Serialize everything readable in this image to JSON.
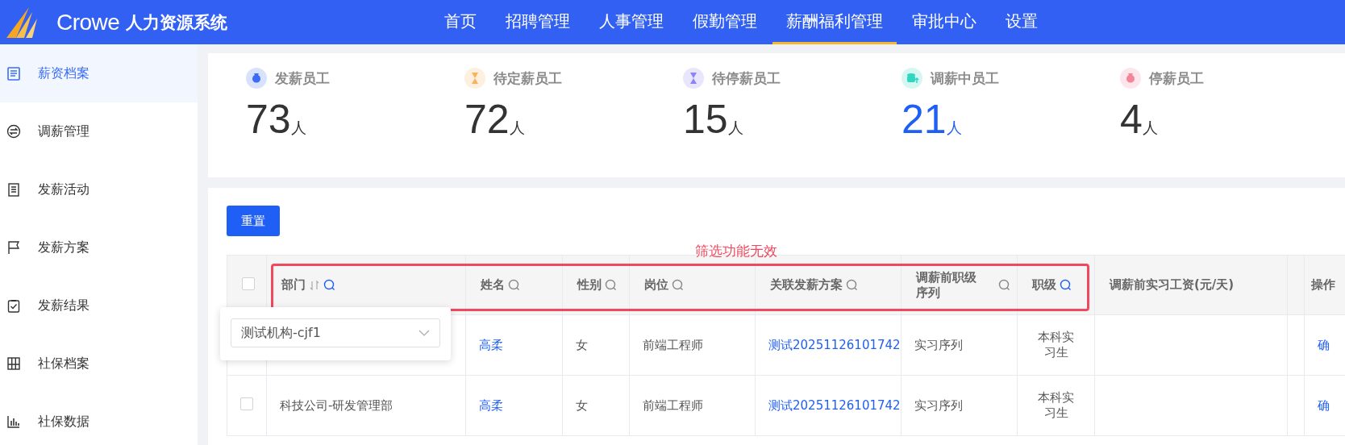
{
  "header": {
    "logo_text": "Crowe",
    "system_name": "人力资源系统",
    "nav": [
      {
        "label": "首页",
        "selected": false
      },
      {
        "label": "招聘管理",
        "selected": false
      },
      {
        "label": "人事管理",
        "selected": false
      },
      {
        "label": "假勤管理",
        "selected": false
      },
      {
        "label": "薪酬福利管理",
        "selected": true
      },
      {
        "label": "审批中心",
        "selected": false
      },
      {
        "label": "设置",
        "selected": false
      }
    ]
  },
  "sidebar": {
    "items": [
      {
        "label": "薪资档案",
        "kind": "document",
        "selected": true
      },
      {
        "label": "调薪管理",
        "kind": "exchange",
        "selected": false
      },
      {
        "label": "发薪活动",
        "kind": "list",
        "selected": false
      },
      {
        "label": "发薪方案",
        "kind": "flag",
        "selected": false
      },
      {
        "label": "发薪结果",
        "kind": "clipboard",
        "selected": false
      },
      {
        "label": "社保档案",
        "kind": "binders",
        "selected": false
      },
      {
        "label": "社保数据",
        "kind": "chart",
        "selected": false
      }
    ]
  },
  "stats": [
    {
      "label": "发薪员工",
      "value": "73",
      "unit": "人",
      "color": "#3b6cf6",
      "kind": "bag",
      "highlight": false
    },
    {
      "label": "待定薪员工",
      "value": "72",
      "unit": "人",
      "color": "#f7b35a",
      "kind": "hourglass",
      "highlight": false
    },
    {
      "label": "待停薪员工",
      "value": "15",
      "unit": "人",
      "color": "#8d83f2",
      "kind": "hourglass",
      "highlight": false
    },
    {
      "label": "调薪中员工",
      "value": "21",
      "unit": "人",
      "color": "#2fd6c0",
      "kind": "coins",
      "highlight": true
    },
    {
      "label": "停薪员工",
      "value": "4",
      "unit": "人",
      "color": "#f4849a",
      "kind": "bag",
      "highlight": false
    }
  ],
  "reset_button": "重置",
  "annotation": {
    "text": "筛选功能无效"
  },
  "filter_popover": {
    "value": "测试机构-cjf1"
  },
  "table": {
    "select_all_checked": false,
    "columns": [
      {
        "kind": "check"
      },
      {
        "label": "部门",
        "kind": "text",
        "filterable": true,
        "filter_active": true,
        "sortable": true
      },
      {
        "label": "姓名",
        "kind": "link",
        "filterable": true,
        "filter_active": false,
        "sortable": false
      },
      {
        "label": "性别",
        "kind": "text",
        "filterable": true,
        "filter_active": false,
        "sortable": false
      },
      {
        "label": "岗位",
        "kind": "text",
        "filterable": true,
        "filter_active": false,
        "sortable": false
      },
      {
        "label": "关联发薪方案",
        "kind": "link",
        "filterable": true,
        "filter_active": false,
        "sortable": false
      },
      {
        "label": "调薪前职级序列",
        "kind": "text",
        "filterable": true,
        "filter_active": false,
        "sortable": false
      },
      {
        "label": "职级",
        "kind": "center",
        "filterable": true,
        "filter_active": true,
        "sortable": false
      },
      {
        "label": "调薪前实习工资(元/天)",
        "kind": "text",
        "filterable": false,
        "sortable": false
      },
      {
        "kind": "text"
      },
      {
        "label": "操作",
        "kind": "link",
        "filterable": false,
        "sortable": false
      }
    ],
    "rows": [
      {
        "cells": [
          null,
          null,
          "高柔",
          "女",
          "前端工程师",
          "测试20251126101742",
          "实习序列",
          "本科实习生",
          null,
          null,
          "确"
        ]
      },
      {
        "checked": false,
        "cells": [
          null,
          "科技公司-研发管理部",
          "高柔",
          "女",
          "前端工程师",
          "测试20251126101742",
          "实习序列",
          "本科实习生",
          null,
          null,
          "确"
        ]
      }
    ]
  }
}
